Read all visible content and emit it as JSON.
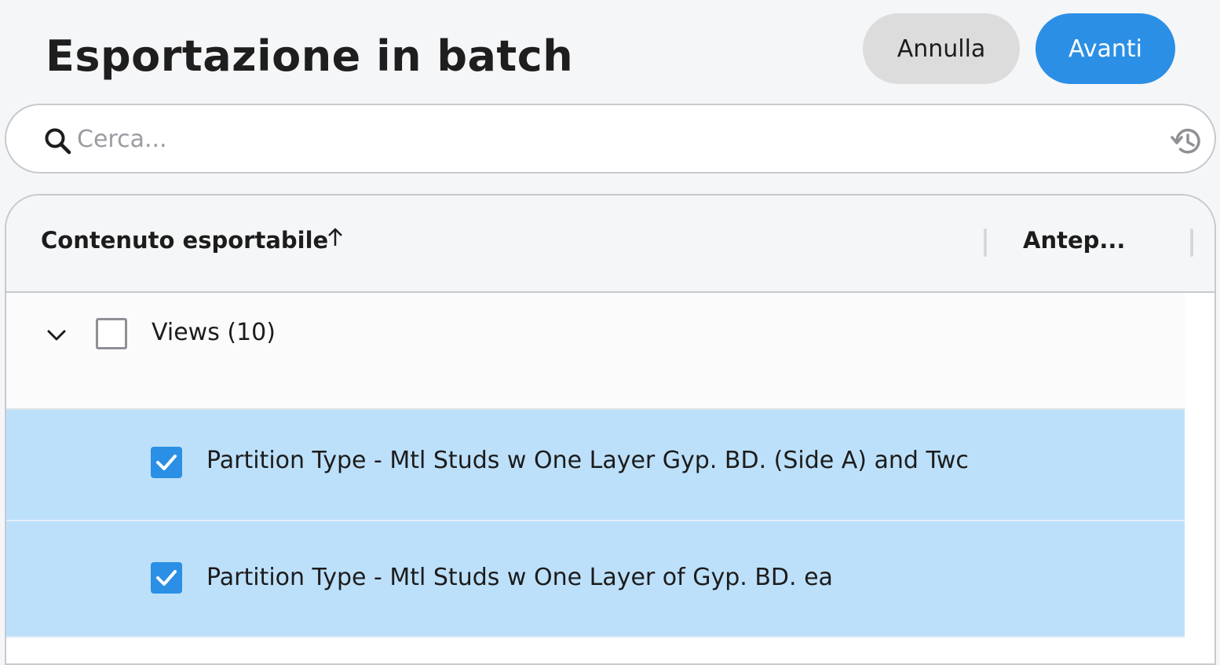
{
  "header": {
    "title": "Esportazione in batch",
    "cancel_label": "Annulla",
    "next_label": "Avanti"
  },
  "search": {
    "placeholder": "Cerca...",
    "value": "",
    "icon": "search-icon",
    "history_icon": "history-icon"
  },
  "table": {
    "columns": [
      {
        "label": "Contenuto esportabile",
        "sorted": "ascending"
      },
      {
        "label": "Antep..."
      }
    ],
    "group": {
      "label": "Views (10)",
      "expanded": true,
      "checked": false
    },
    "items": [
      {
        "label": "Partition Type - Mtl Studs w One Layer Gyp. BD. (Side A) and Twc",
        "checked": true
      },
      {
        "label": "Partition Type - Mtl Studs w One Layer of Gyp. BD. ea",
        "checked": true
      }
    ]
  },
  "colors": {
    "accent": "#2b8fe5",
    "selected_row": "#bde0fa",
    "cancel_bg": "#dcdcdc",
    "background": "#f5f6f8"
  }
}
